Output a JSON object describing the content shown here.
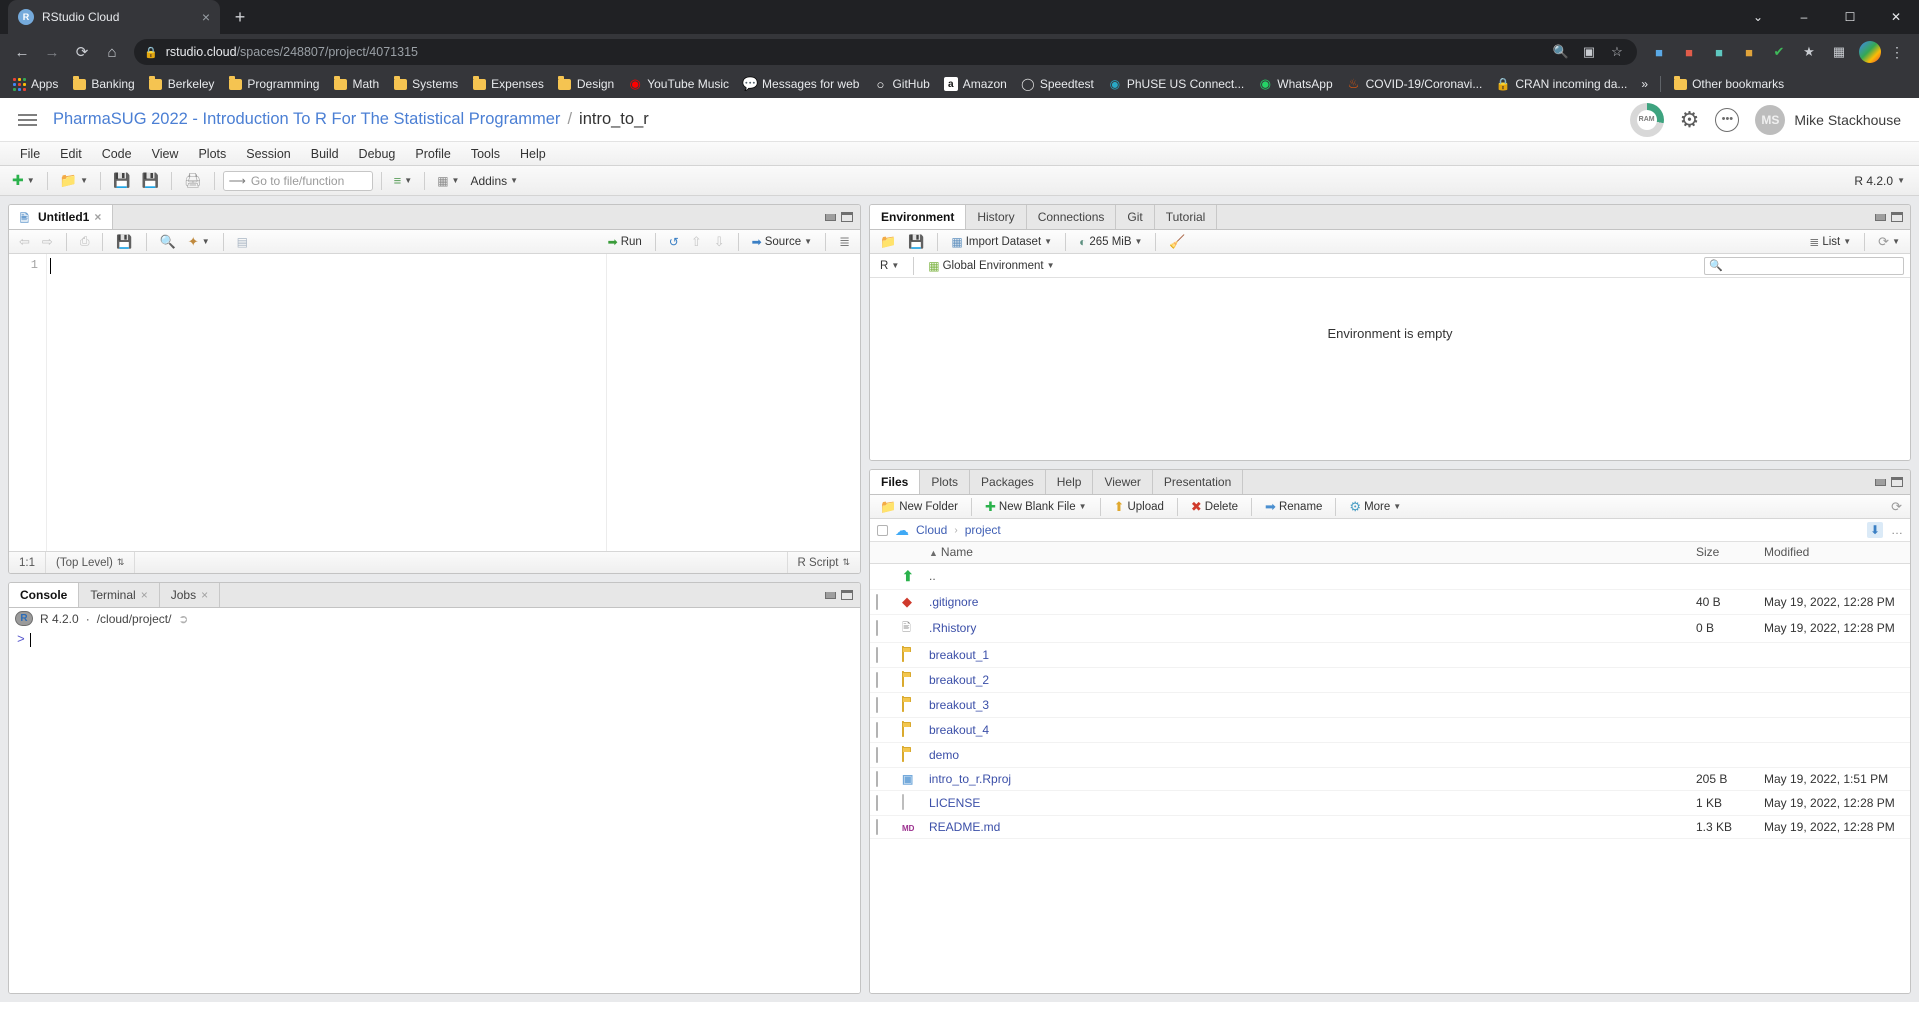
{
  "browser": {
    "tab": {
      "title": "RStudio Cloud",
      "favicon_letter": "R",
      "close_label": "×"
    },
    "newtab_label": "+",
    "window_buttons": {
      "more": "⌄",
      "minimize": "–",
      "maximize": "☐",
      "close": "✕"
    },
    "nav": {
      "back": "←",
      "forward": "→",
      "reload": "⟳",
      "home": "⌂"
    },
    "omnibox": {
      "lock_icon": "🔒",
      "url_domain": "rstudio.cloud",
      "url_path": "/spaces/248807/project/4071315",
      "zoom_icon": "🔍",
      "extension_icon": "▣",
      "star_icon": "☆"
    },
    "bookmarks": [
      {
        "label": "Apps",
        "icon": "apps-grid-icon"
      },
      {
        "label": "Banking",
        "icon": "folder-icon"
      },
      {
        "label": "Berkeley",
        "icon": "folder-icon"
      },
      {
        "label": "Programming",
        "icon": "folder-icon"
      },
      {
        "label": "Math",
        "icon": "folder-icon"
      },
      {
        "label": "Systems",
        "icon": "folder-icon"
      },
      {
        "label": "Expenses",
        "icon": "folder-icon"
      },
      {
        "label": "Design",
        "icon": "folder-icon"
      },
      {
        "label": "YouTube Music",
        "icon": "youtube-music-icon"
      },
      {
        "label": "Messages for web",
        "icon": "messages-icon"
      },
      {
        "label": "GitHub",
        "icon": "github-icon"
      },
      {
        "label": "Amazon",
        "icon": "amazon-icon"
      },
      {
        "label": "Speedtest",
        "icon": "speedtest-icon"
      },
      {
        "label": "PhUSE US Connect...",
        "icon": "phuse-icon"
      },
      {
        "label": "WhatsApp",
        "icon": "whatsapp-icon"
      },
      {
        "label": "COVID-19/Coronavi...",
        "icon": "covid-icon"
      },
      {
        "label": "CRAN incoming da...",
        "icon": "lock-icon"
      }
    ],
    "bookmarks_overflow": "»",
    "other_bookmarks": "Other bookmarks"
  },
  "rsc_header": {
    "space_name": "PharmaSUG 2022 - Introduction To R For The Statistical Programmer",
    "separator": "/",
    "project_name": "intro_to_r",
    "ram_label": "RAM",
    "gear_icon": "⚙",
    "more_icon": "•••",
    "avatar_initials": "MS",
    "user_name": "Mike Stackhouse"
  },
  "ide": {
    "menu": [
      "File",
      "Edit",
      "Code",
      "View",
      "Plots",
      "Session",
      "Build",
      "Debug",
      "Profile",
      "Tools",
      "Help"
    ],
    "toolbar": {
      "new_file_label": "⊕",
      "open_label": "📂",
      "save_label": "💾",
      "save_all_label": "💾",
      "print_label": "🖨",
      "goto_placeholder": "Go to file/function",
      "addins_label": "Addins",
      "r_version": "R 4.2.0"
    }
  },
  "source_pane": {
    "tab_label": "Untitled1",
    "tab_close": "×",
    "toolbar": {
      "back": "⇦",
      "forward": "⇨",
      "show_doc": "↗",
      "save": "💾",
      "find": "🔍",
      "magic": "✨",
      "compile": "☰",
      "run_label": "Run",
      "rerun": "↺",
      "up": "⇧",
      "down": "⇩",
      "source_label": "Source",
      "outline": "≡"
    },
    "line_numbers": [
      "1"
    ],
    "content": "",
    "status": {
      "cursor_position": "1:1",
      "scope": "(Top Level)",
      "file_type": "R Script"
    }
  },
  "console_pane": {
    "tabs": [
      {
        "label": "Console",
        "active": true,
        "closable": false
      },
      {
        "label": "Terminal",
        "active": false,
        "closable": true
      },
      {
        "label": "Jobs",
        "active": false,
        "closable": true
      }
    ],
    "close_glyph": "×",
    "r_version": "R 4.2.0",
    "path_separator": "·",
    "working_dir": "/cloud/project/",
    "prompt": ">"
  },
  "environment_pane": {
    "tabs": [
      {
        "label": "Environment",
        "active": true
      },
      {
        "label": "History",
        "active": false
      },
      {
        "label": "Connections",
        "active": false
      },
      {
        "label": "Git",
        "active": false
      },
      {
        "label": "Tutorial",
        "active": false
      }
    ],
    "toolbar": {
      "load_label": "📂",
      "save_label": "💾",
      "import_label": "Import Dataset",
      "memory_label": "265 MiB",
      "broom_label": "🧹",
      "view_mode": "List",
      "refresh_label": "⟳"
    },
    "scope": {
      "language": "R",
      "environment_name": "Global Environment"
    },
    "search_placeholder": "",
    "empty_message": "Environment is empty"
  },
  "files_pane": {
    "tabs": [
      {
        "label": "Files",
        "active": true
      },
      {
        "label": "Plots",
        "active": false
      },
      {
        "label": "Packages",
        "active": false
      },
      {
        "label": "Help",
        "active": false
      },
      {
        "label": "Viewer",
        "active": false
      },
      {
        "label": "Presentation",
        "active": false
      }
    ],
    "toolbar": [
      {
        "label": "New Folder",
        "icon": "new-folder-icon"
      },
      {
        "label": "New Blank File",
        "icon": "new-file-icon",
        "has_caret": true
      },
      {
        "label": "Upload",
        "icon": "upload-icon"
      },
      {
        "label": "Delete",
        "icon": "delete-icon"
      },
      {
        "label": "Rename",
        "icon": "rename-icon"
      },
      {
        "label": "More",
        "icon": "gear-icon",
        "has_caret": true
      }
    ],
    "breadcrumb": {
      "root": "Cloud",
      "separator": "›",
      "current": "project"
    },
    "refresh_icon": "⟳",
    "more_icon": "…",
    "columns": {
      "name": "Name",
      "size": "Size",
      "modified": "Modified",
      "sort_arrow": "▲"
    },
    "rows": [
      {
        "name": "..",
        "icon": "up-folder-icon",
        "size": "",
        "modified": "",
        "checkbox": false
      },
      {
        "name": ".gitignore",
        "icon": "git-file-icon",
        "size": "40 B",
        "modified": "May 19, 2022, 12:28 PM",
        "checkbox": true
      },
      {
        "name": ".Rhistory",
        "icon": "rhistory-file-icon",
        "size": "0 B",
        "modified": "May 19, 2022, 12:28 PM",
        "checkbox": true
      },
      {
        "name": "breakout_1",
        "icon": "folder-icon",
        "size": "",
        "modified": "",
        "checkbox": true
      },
      {
        "name": "breakout_2",
        "icon": "folder-icon",
        "size": "",
        "modified": "",
        "checkbox": true
      },
      {
        "name": "breakout_3",
        "icon": "folder-icon",
        "size": "",
        "modified": "",
        "checkbox": true
      },
      {
        "name": "breakout_4",
        "icon": "folder-icon",
        "size": "",
        "modified": "",
        "checkbox": true
      },
      {
        "name": "demo",
        "icon": "folder-icon",
        "size": "",
        "modified": "",
        "checkbox": true
      },
      {
        "name": "intro_to_r.Rproj",
        "icon": "rproj-file-icon",
        "size": "205 B",
        "modified": "May 19, 2022, 1:51 PM",
        "checkbox": true
      },
      {
        "name": "LICENSE",
        "icon": "plain-file-icon",
        "size": "1 KB",
        "modified": "May 19, 2022, 12:28 PM",
        "checkbox": true
      },
      {
        "name": "README.md",
        "icon": "markdown-file-icon",
        "size": "1.3 KB",
        "modified": "May 19, 2022, 12:28 PM",
        "checkbox": true
      }
    ]
  },
  "colors": {
    "chrome_dark": "#202124",
    "chrome_tab": "#35363a",
    "rstudio_blue": "#75aadb",
    "link_blue": "#4b7fd4",
    "file_link": "#3b4fa8",
    "folder_yellow": "#f3c64e",
    "run_green": "#3a9c3a"
  }
}
